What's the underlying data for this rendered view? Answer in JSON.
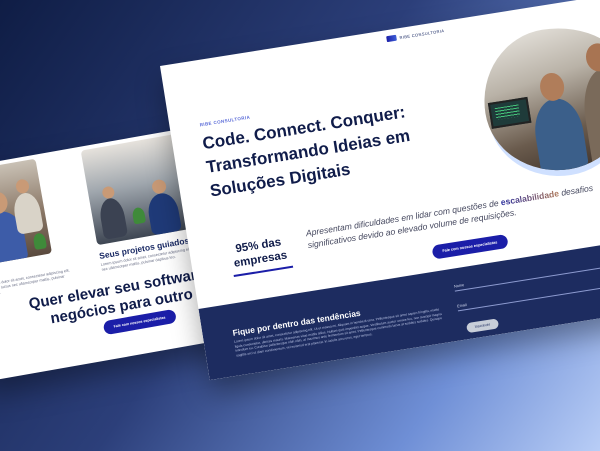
{
  "back_page": {
    "card_left_title_fragment": "ada",
    "card_left_body": "Lorem ipsum dolor sit amet, consectetur adipiscing elit. Ut elit tellus, luctus nec ullamcorper mattis, pulvinar dapibus leo.",
    "card_right_title": "Seus projetos guiados do zero",
    "card_right_body": "Lorem ipsum dolor sit amet, consectetur adipiscing elit. Ut elit tellus, luctus nec ullamcorper mattis, pulvinar dapibus leo.",
    "heading": "Quer elevar seu software e seus negócios para outro nível?",
    "cta_label": "Fale com nossos especialistas"
  },
  "front_page": {
    "logo_text": "RIBE CONSULTORIA",
    "eyebrow": "RIBE CONSULTORIA",
    "headline": "Code. Connect. Conquer: Transformando Ideias em Soluções Digitais",
    "stat": "95% das empresas",
    "desc_before": "Apresentam dificuldades em lidar com questões de ",
    "desc_highlight": "escalabilidade",
    "desc_after": " desafios significativos devido ao elevado volume de requisições.",
    "cta_label": "Fale com nossos especialistas",
    "footer": {
      "title": "Fique por dentro das tendências",
      "body": "Lorem ipsum dolor sit amet, consectetur adipiscing elit. Ut et massa mi. Aliquam in hendrerit urna. Pellentesque sit amet sapien fringilla, mattis ligula consectetur, ultrices mauris. Maecenas vitae mattis tellus. Nullam quis imperdiet augue. Vestibulum auctor ornare leo, non suscipit magna interdum eu. Curabitur pellentesque nibh nibh, at maximus ante fermentum sit amet. Pellentesque commodo lacus at sodales sodales. Quisque sagittis orci ut diam condimentum, vel euismod erat placerat. In iaculis arcu eros, eget tempus.",
      "name_label": "Nome",
      "email_label": "Email",
      "submit_label": "Inscrever"
    }
  }
}
